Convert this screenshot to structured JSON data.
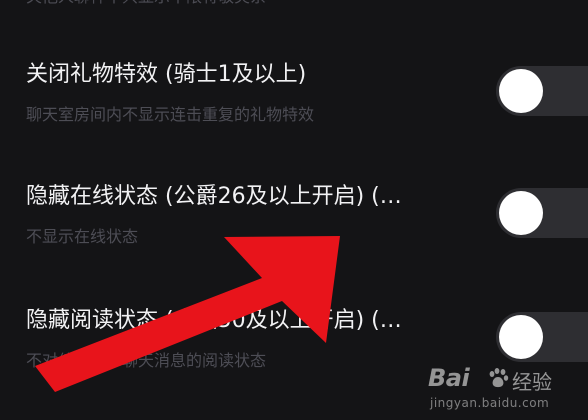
{
  "settings": {
    "items": [
      {
        "description": "关他人聊神不只显示不限将敬突系"
      },
      {
        "title": "关闭礼物特效 (骑士1及以上)",
        "description": "聊天室房间内不显示连击重复的礼物特效",
        "toggle_on": false
      },
      {
        "title": "隐藏在线状态 (公爵26及以上开启) (…",
        "description": "不显示在线状态",
        "toggle_on": false
      },
      {
        "title": "隐藏阅读状态 (金仙50及以上开启) (…",
        "description": "不对他人显示聊天消息的阅读状态",
        "toggle_on": false
      }
    ]
  },
  "annotation": {
    "arrow_color": "#e8141b",
    "arrow_icon": "red-arrow-icon"
  },
  "watermark": {
    "logo_text": "Bai",
    "brand_text": "经验",
    "url": "jingyan.baidu.com",
    "icon": "baidu-paw-icon"
  },
  "colors": {
    "background": "#141416",
    "title_text": "#f2f2f4",
    "description_text": "#4d4d55",
    "toggle_track": "#2e2e32",
    "toggle_knob": "#ffffff"
  }
}
